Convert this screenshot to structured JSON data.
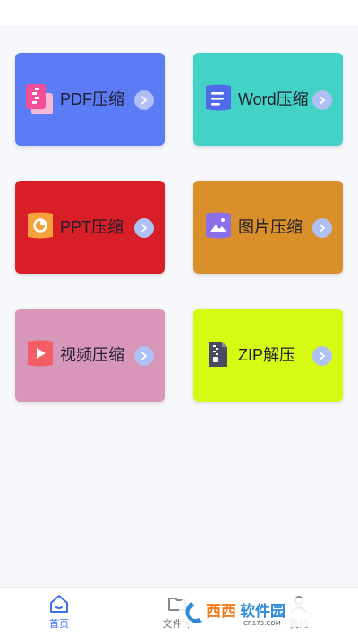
{
  "colors": {
    "pdf": "#5C7CF6",
    "word": "#45D2C6",
    "ppt": "#D81E26",
    "image": "#D98F2A",
    "video": "#D897B8",
    "zip": "#D6FA14",
    "arrow": "#AFC0F5",
    "tab_active": "#3A6FF0"
  },
  "cards": [
    {
      "key": "pdf",
      "label": "PDF压缩",
      "icon": "pdf-file-icon"
    },
    {
      "key": "word",
      "label": "Word压缩",
      "icon": "word-file-icon"
    },
    {
      "key": "ppt",
      "label": "PPT压缩",
      "icon": "ppt-file-icon"
    },
    {
      "key": "image",
      "label": "图片压缩",
      "icon": "image-file-icon"
    },
    {
      "key": "video",
      "label": "视频压缩",
      "icon": "video-file-icon"
    },
    {
      "key": "zip",
      "label": "ZIP解压",
      "icon": "zip-file-icon"
    }
  ],
  "tabbar": {
    "active": "home",
    "items": [
      {
        "key": "home",
        "label": "首页",
        "icon": "home-icon"
      },
      {
        "key": "files",
        "label": "文件库",
        "icon": "folder-icon"
      },
      {
        "key": "mine",
        "label": "我的",
        "icon": "user-icon"
      }
    ]
  },
  "watermark": {
    "brand": "西西软件园",
    "site": "CR173.COM"
  }
}
